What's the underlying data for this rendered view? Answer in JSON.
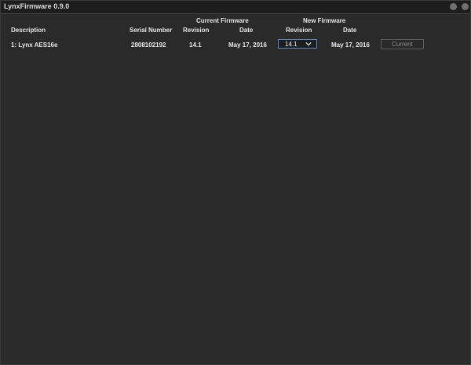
{
  "window": {
    "title": "LynxFirmware 0.9.0"
  },
  "table": {
    "group_headers": {
      "current_firmware": "Current Firmware",
      "new_firmware": "New Firmware"
    },
    "columns": {
      "description": "Description",
      "serial_number": "Serial Number",
      "current_revision": "Revision",
      "current_date": "Date",
      "new_revision": "Revision",
      "new_date": "Date"
    },
    "rows": [
      {
        "description": "1: Lynx AES16e",
        "serial_number": "2808102192",
        "current_revision": "14.1",
        "current_date": "May 17, 2016",
        "new_revision": "14.1",
        "new_date": "May 17, 2016",
        "action_label": "Current"
      }
    ]
  }
}
